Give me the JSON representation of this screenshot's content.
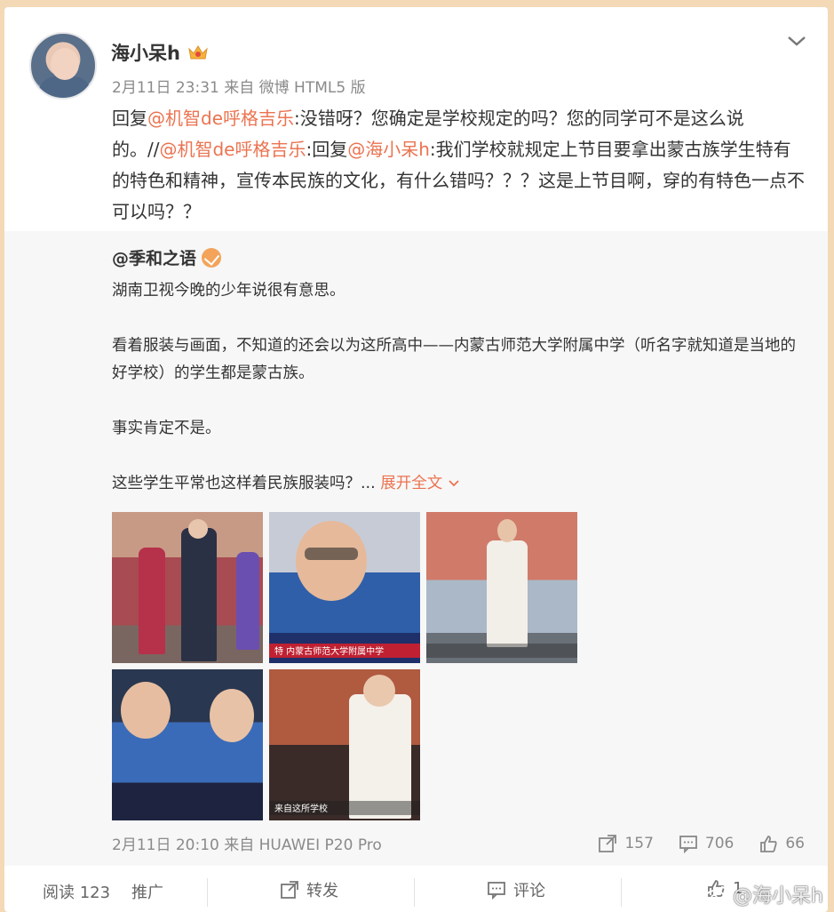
{
  "post": {
    "username": "海小呆h",
    "meta": "2月11日 23:31 来自 微博 HTML5 版",
    "body": {
      "t1": "回复",
      "m1": "@机智de呼格吉乐",
      "t2": ":没错呀？您确定是学校规定的吗？您的同学可不是这么说的。//",
      "m2": "@机智de呼格吉乐",
      "t3": ":回复",
      "m3": "@海小呆h",
      "t4": ":我们学校就规定上节目要拿出蒙古族学生特有的特色和精神，宣传本民族的文化，有什么错吗？？？这是上节目啊，穿的有特色一点不可以吗？？"
    }
  },
  "repost": {
    "author": "@季和之语",
    "paragraphs": [
      "湖南卫视今晚的少年说很有意思。",
      "看着服装与画面，不知道的还会以为这所高中——内蒙古师范大学附属中学（听名字就知道是当地的好学校）的学生都是蒙古族。",
      "事实肯定不是。"
    ],
    "truncated": "这些学生平常也这样着民族服装吗？...",
    "expand_label": "展开全文",
    "photo_captions": [
      "特 内蒙古师范大学附属中学",
      "来自这所学校"
    ],
    "meta": "2月11日 20:10 来自 HUAWEI P20 Pro",
    "reposts": "157",
    "comments": "706",
    "likes": "66"
  },
  "bottom": {
    "read": "阅读 123",
    "promote": "推广",
    "repost": "转发",
    "comment": "评论",
    "like": "1"
  },
  "watermark": "@海小呆h",
  "colors": {
    "link": "#eb7350",
    "background": "#f3d9b6"
  },
  "icons": [
    "crown-icon",
    "vip-icon",
    "chevron-down-icon",
    "repost-icon",
    "comment-icon",
    "like-icon",
    "weibo-logo-icon"
  ]
}
